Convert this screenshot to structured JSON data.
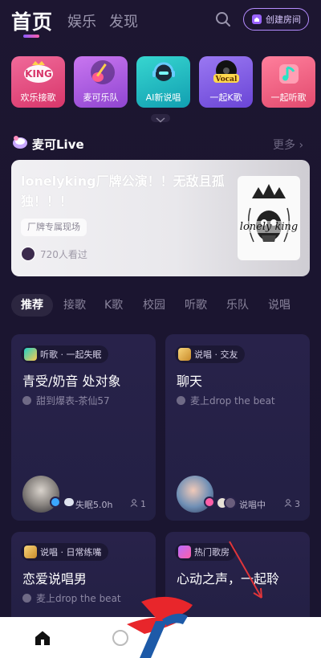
{
  "topnav": {
    "main_tab": "首页",
    "tabs": [
      "娱乐",
      "发现"
    ],
    "create_room": "创建房间"
  },
  "categories": [
    {
      "label": "欢乐接歌",
      "color": "#e24d7c",
      "icon": "king-mic-icon"
    },
    {
      "label": "麦可乐队",
      "color": "#b455d8",
      "icon": "guitar-icon"
    },
    {
      "label": "AI新说唱",
      "color": "#1bb8c4",
      "icon": "robot-headphones-icon"
    },
    {
      "label": "一起K歌",
      "color": "#7f5ce6",
      "icon": "vocal-record-icon"
    },
    {
      "label": "一起听歌",
      "color": "#ee5a7c",
      "icon": "music-note-icon"
    }
  ],
  "live": {
    "section_title": "麦可Live",
    "more": "更多 ›",
    "title": "lonelyking厂牌公演！！无敌且孤独！！！",
    "tag": "厂牌专属现场",
    "viewers": "720人看过",
    "cover_text": "lonely king"
  },
  "filters": [
    "推荐",
    "接歌",
    "K歌",
    "校园",
    "听歌",
    "乐队",
    "说唱"
  ],
  "rooms": [
    {
      "badge": "听歌 · 一起失眠",
      "title": "青受/奶音 处对象",
      "sub": "甜到爆表-茶仙57",
      "foot": "失眠5.0h",
      "count": "1"
    },
    {
      "badge": "说唱 · 交友",
      "title": "聊天",
      "sub": "麦上drop the beat",
      "foot": "说唱中",
      "count": "3"
    },
    {
      "badge": "说唱 · 日常练嘴",
      "title": "恋爱说唱男",
      "sub": "麦上drop the beat"
    },
    {
      "badge": "热门歌房",
      "title": "心动之声，一起聆",
      "sub": ""
    }
  ]
}
